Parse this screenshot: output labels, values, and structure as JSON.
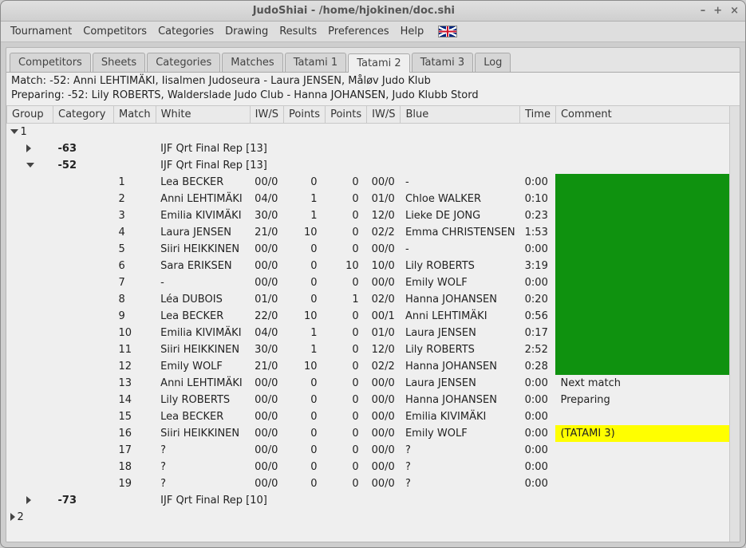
{
  "window": {
    "title": "JudoShiai - /home/hjokinen/doc.shi",
    "min": "–",
    "max": "+",
    "close": "×"
  },
  "menubar": {
    "items": [
      "Tournament",
      "Competitors",
      "Categories",
      "Drawing",
      "Results",
      "Preferences",
      "Help"
    ]
  },
  "tabs": {
    "items": [
      "Competitors",
      "Sheets",
      "Categories",
      "Matches",
      "Tatami 1",
      "Tatami 2",
      "Tatami 3",
      "Log"
    ],
    "active_index": 5
  },
  "info": {
    "line1": "Match: -52: Anni LEHTIMÄKI, Iisalmen Judoseura - Laura JENSEN, Måløv Judo Klub",
    "line2": "Preparing: -52: Lily ROBERTS, Walderslade Judo Club - Hanna JOHANSEN, Judo Klubb Stord"
  },
  "columns": {
    "group": "Group",
    "category": "Category",
    "match": "Match",
    "white": "White",
    "iws1": "IW/S",
    "pts1": "Points",
    "pts2": "Points",
    "iws2": "IW/S",
    "blue": "Blue",
    "time": "Time",
    "comment": "Comment"
  },
  "tree": {
    "group1_label": "1",
    "group2_label": "2",
    "cat63": {
      "label": "-63",
      "desc": "IJF Qrt Final Rep [13]"
    },
    "cat52": {
      "label": "-52",
      "desc": "IJF Qrt Final Rep [13]"
    },
    "cat73": {
      "label": "-73",
      "desc": "IJF Qrt Final Rep [10]"
    }
  },
  "matches": [
    {
      "n": "1",
      "white": "Lea BECKER",
      "iws1": "00/0",
      "p1": "0",
      "p2": "0",
      "iws2": "00/0",
      "blue": "-",
      "time": "0:00",
      "comment_style": "green",
      "comment": ""
    },
    {
      "n": "2",
      "white": "Anni LEHTIMÄKI",
      "iws1": "04/0",
      "p1": "1",
      "p2": "0",
      "iws2": "01/0",
      "blue": "Chloe WALKER",
      "time": "0:10",
      "comment_style": "green",
      "comment": ""
    },
    {
      "n": "3",
      "white": "Emilia KIVIMÄKI",
      "iws1": "30/0",
      "p1": "1",
      "p2": "0",
      "iws2": "12/0",
      "blue": "Lieke DE JONG",
      "time": "0:23",
      "comment_style": "green",
      "comment": ""
    },
    {
      "n": "4",
      "white": "Laura JENSEN",
      "iws1": "21/0",
      "p1": "10",
      "p2": "0",
      "iws2": "02/2",
      "blue": "Emma CHRISTENSEN",
      "time": "1:53",
      "comment_style": "green",
      "comment": ""
    },
    {
      "n": "5",
      "white": "Siiri HEIKKINEN",
      "iws1": "00/0",
      "p1": "0",
      "p2": "0",
      "iws2": "00/0",
      "blue": "-",
      "time": "0:00",
      "comment_style": "green",
      "comment": ""
    },
    {
      "n": "6",
      "white": "Sara ERIKSEN",
      "iws1": "00/0",
      "p1": "0",
      "p2": "10",
      "iws2": "10/0",
      "blue": "Lily ROBERTS",
      "time": "3:19",
      "comment_style": "green",
      "comment": ""
    },
    {
      "n": "7",
      "white": "-",
      "iws1": "00/0",
      "p1": "0",
      "p2": "0",
      "iws2": "00/0",
      "blue": "Emily WOLF",
      "time": "0:00",
      "comment_style": "green",
      "comment": ""
    },
    {
      "n": "8",
      "white": "Léa DUBOIS",
      "iws1": "01/0",
      "p1": "0",
      "p2": "1",
      "iws2": "02/0",
      "blue": "Hanna JOHANSEN",
      "time": "0:20",
      "comment_style": "green",
      "comment": ""
    },
    {
      "n": "9",
      "white": "Lea BECKER",
      "iws1": "22/0",
      "p1": "10",
      "p2": "0",
      "iws2": "00/1",
      "blue": "Anni LEHTIMÄKI",
      "time": "0:56",
      "comment_style": "green",
      "comment": ""
    },
    {
      "n": "10",
      "white": "Emilia KIVIMÄKI",
      "iws1": "04/0",
      "p1": "1",
      "p2": "0",
      "iws2": "01/0",
      "blue": "Laura JENSEN",
      "time": "0:17",
      "comment_style": "green",
      "comment": ""
    },
    {
      "n": "11",
      "white": "Siiri HEIKKINEN",
      "iws1": "30/0",
      "p1": "1",
      "p2": "0",
      "iws2": "12/0",
      "blue": "Lily ROBERTS",
      "time": "2:52",
      "comment_style": "green",
      "comment": ""
    },
    {
      "n": "12",
      "white": "Emily WOLF",
      "iws1": "21/0",
      "p1": "10",
      "p2": "0",
      "iws2": "02/2",
      "blue": "Hanna JOHANSEN",
      "time": "0:28",
      "comment_style": "green",
      "comment": ""
    },
    {
      "n": "13",
      "white": "Anni LEHTIMÄKI",
      "iws1": "00/0",
      "p1": "0",
      "p2": "0",
      "iws2": "00/0",
      "blue": "Laura JENSEN",
      "time": "0:00",
      "comment_style": "plain",
      "comment": "Next match"
    },
    {
      "n": "14",
      "white": "Lily ROBERTS",
      "iws1": "00/0",
      "p1": "0",
      "p2": "0",
      "iws2": "00/0",
      "blue": "Hanna JOHANSEN",
      "time": "0:00",
      "comment_style": "plain",
      "comment": "Preparing"
    },
    {
      "n": "15",
      "white": "Lea BECKER",
      "iws1": "00/0",
      "p1": "0",
      "p2": "0",
      "iws2": "00/0",
      "blue": "Emilia KIVIMÄKI",
      "time": "0:00",
      "comment_style": "plain",
      "comment": ""
    },
    {
      "n": "16",
      "white": "Siiri HEIKKINEN",
      "iws1": "00/0",
      "p1": "0",
      "p2": "0",
      "iws2": "00/0",
      "blue": "Emily WOLF",
      "time": "0:00",
      "comment_style": "yellow",
      "comment": "(TATAMI 3)"
    },
    {
      "n": "17",
      "white": "?",
      "iws1": "00/0",
      "p1": "0",
      "p2": "0",
      "iws2": "00/0",
      "blue": "?",
      "time": "0:00",
      "comment_style": "plain",
      "comment": ""
    },
    {
      "n": "18",
      "white": "?",
      "iws1": "00/0",
      "p1": "0",
      "p2": "0",
      "iws2": "00/0",
      "blue": "?",
      "time": "0:00",
      "comment_style": "plain",
      "comment": ""
    },
    {
      "n": "19",
      "white": "?",
      "iws1": "00/0",
      "p1": "0",
      "p2": "0",
      "iws2": "00/0",
      "blue": "?",
      "time": "0:00",
      "comment_style": "plain",
      "comment": ""
    }
  ]
}
